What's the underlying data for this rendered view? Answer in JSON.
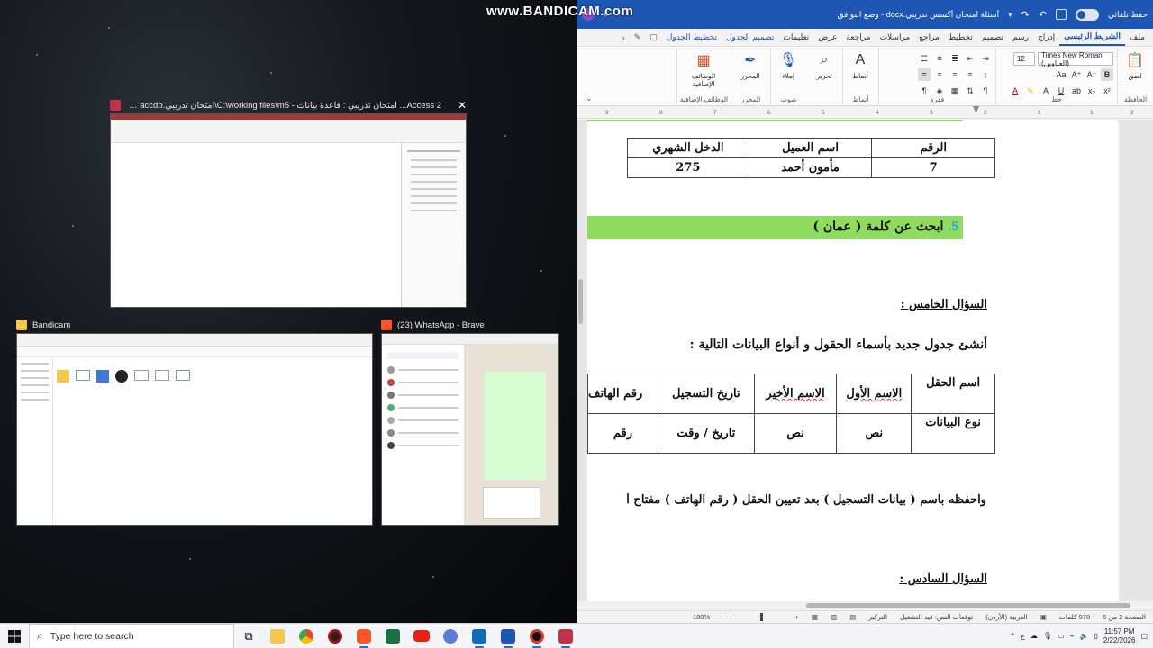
{
  "watermark": "www.BANDICAM.com",
  "task_view": {
    "access": {
      "title": "Access 2... امتحان تدريبي : قاعدة بيانات - C:\\working files\\m5\\امتحان تدريبي.accdb (تنسيق ملف Access",
      "close": "✕"
    },
    "bandicam": {
      "title": "Bandicam"
    },
    "whatsapp": {
      "title": "(23) WhatsApp - Brave"
    }
  },
  "word": {
    "titlebar": {
      "autosave_label": "حفظ تلقائي",
      "doc_title": "أسئلة امتحان أكسس تدريبي.docx - وضع التوافق",
      "avatar": "IA"
    },
    "tabs": [
      "ملف",
      "الشريط الرئيسي",
      "إدراج",
      "رسم",
      "تصميم",
      "تخطيط",
      "مراجع",
      "مراسلات",
      "مراجعة",
      "عرض",
      "تعليمات",
      "تصميم الجدول",
      "تخطيط الجدول"
    ],
    "active_tab": "الشريط الرئيسي",
    "ribbon": {
      "groups": {
        "clipboard": "الحافظة",
        "font": "خط",
        "paragraph": "فقرة",
        "styles": "أنماط",
        "voice": "صوت",
        "editor": "المحرر",
        "addins": "الوظائف الإضافية"
      },
      "paste_label": "لصق",
      "font_name": "Times New Roman (العناوين)",
      "font_size": "12",
      "styles_label": "أنماط",
      "editing_label": "تحرير",
      "dictate_label": "إملاء",
      "editor_label": "المحرر",
      "addins_label": "الوظائف الإضافية"
    },
    "ruler_ticks": [
      "9",
      "8",
      "7",
      "6",
      "5",
      "4",
      "3",
      "2",
      "1",
      "1",
      "2"
    ],
    "document": {
      "table1": {
        "headers": [
          "الرقم",
          "اسم العميل",
          "الدخل الشهري"
        ],
        "row": [
          "7",
          "مأمون أحمد",
          "275"
        ]
      },
      "q5_number": "5.",
      "q5_text": "ابحث عن كلمة ( عمان )",
      "section_five": "السؤال الخامس :",
      "create_table_text": "أنشئ جدول جديد بأسماء الحقول و أنواع البيانات التالية :",
      "table2": {
        "field_label": "اسم الحقل",
        "type_label": "نوع البيانات",
        "fields": [
          "الاسم الأول",
          "الاسم الأخير",
          "تاريخ التسجيل",
          "رقم الهاتف"
        ],
        "types": [
          "نص",
          "نص",
          "تاريخ / وقت",
          "رقم"
        ]
      },
      "save_text": "واحفظه باسم ( بيانات التسجيل ) بعد تعيين الحقل ( رقم الهاتف ) مفتاح أ",
      "section_six": "السؤال السادس :"
    },
    "statusbar": {
      "page": "الصفحة 2 من 6",
      "words": "970 كلمات",
      "language": "العربية (الأردن)",
      "predictions": "توقعات النص: قيد التشغيل",
      "focus": "التركيز",
      "zoom": "180%"
    }
  },
  "taskbar": {
    "search_placeholder": "Type here to search",
    "time": "11:57 PM",
    "date": "2/22/2026",
    "lang": "ع"
  }
}
